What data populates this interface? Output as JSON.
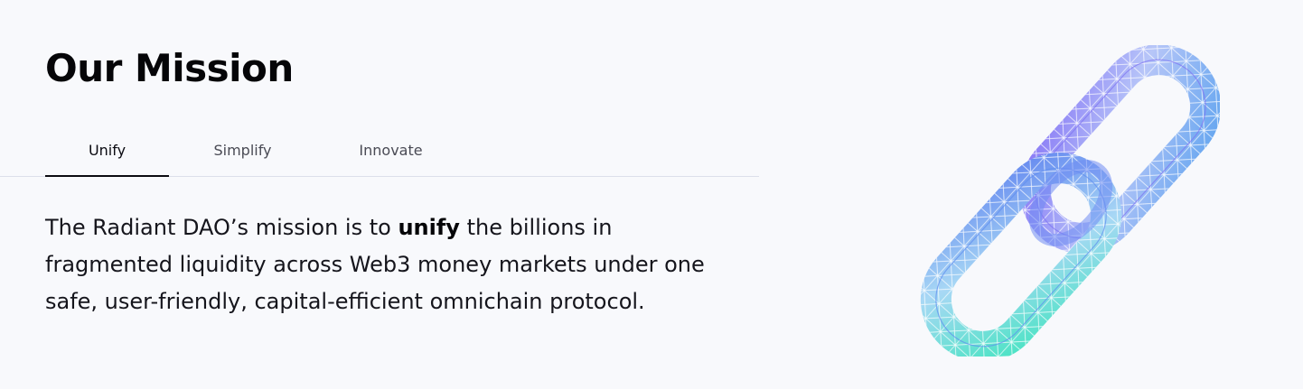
{
  "section": {
    "title": "Our Mission"
  },
  "tabs": [
    {
      "label": "Unify",
      "active": true
    },
    {
      "label": "Simplify",
      "active": false
    },
    {
      "label": "Innovate",
      "active": false
    }
  ],
  "mission": {
    "before": "The Radiant DAO’s mission is to ",
    "highlight": "unify",
    "after": " the billions in fragmented liquidity across Web3 money markets under one safe, user-friendly, capital-efficient omnichain protocol."
  },
  "colors": {
    "background": "#f8f9fc",
    "text": "#0b0b12",
    "tab_inactive": "#4a4b55",
    "divider": "#dcdfea",
    "chain_purple": "#8b7cf6",
    "chain_blue": "#6aa8f0",
    "chain_teal": "#4fe3c6"
  },
  "illustration": {
    "icon": "chain-link-icon"
  }
}
